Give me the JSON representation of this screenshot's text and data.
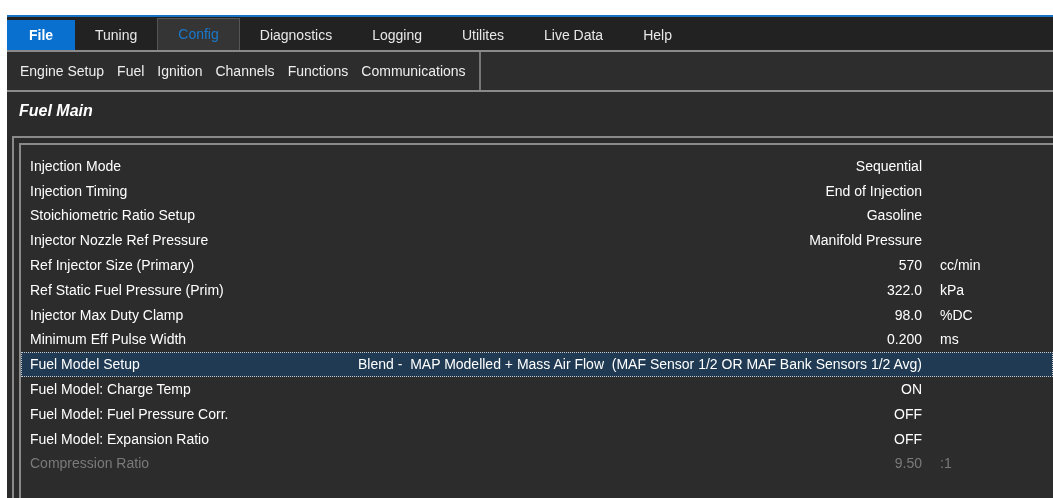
{
  "menu_tabs": [
    {
      "label": "File",
      "kind": "file",
      "selected": false
    },
    {
      "label": "Tuning",
      "kind": "tab",
      "selected": false
    },
    {
      "label": "Config",
      "kind": "tab",
      "selected": true
    },
    {
      "label": "Diagnostics",
      "kind": "tab",
      "selected": false
    },
    {
      "label": "Logging",
      "kind": "tab",
      "selected": false
    },
    {
      "label": "Utilites",
      "kind": "tab",
      "selected": false
    },
    {
      "label": "Live Data",
      "kind": "tab",
      "selected": false
    },
    {
      "label": "Help",
      "kind": "tab",
      "selected": false
    }
  ],
  "toolbar": {
    "items": [
      "Engine Setup",
      "Fuel",
      "Ignition",
      "Channels",
      "Functions",
      "Communications"
    ]
  },
  "panel": {
    "title": "Fuel Main"
  },
  "settings": [
    {
      "name": "Injection Mode",
      "value": "Sequential",
      "selected": false,
      "disabled": false
    },
    {
      "name": "Injection Timing",
      "value": "End of Injection",
      "selected": false,
      "disabled": false
    },
    {
      "name": "Stoichiometric Ratio Setup",
      "value": "Gasoline",
      "selected": false,
      "disabled": false
    },
    {
      "name": "Injector Nozzle Ref Pressure",
      "value": "Manifold Pressure",
      "selected": false,
      "disabled": false
    },
    {
      "name": "Ref Injector Size (Primary)",
      "value": "570",
      "unit": "cc/min",
      "selected": false,
      "disabled": false
    },
    {
      "name": "Ref Static Fuel Pressure (Prim)",
      "value": "322.0",
      "unit": "kPa",
      "selected": false,
      "disabled": false
    },
    {
      "name": "Injector Max Duty Clamp",
      "value": "98.0",
      "unit": "%DC",
      "selected": false,
      "disabled": false
    },
    {
      "name": "Minimum Eff Pulse Width",
      "value": "0.200",
      "unit": "ms",
      "selected": false,
      "disabled": false
    },
    {
      "name": "Fuel Model Setup",
      "value": "Blend -  MAP Modelled + Mass Air Flow  (MAF Sensor 1/2 OR MAF Bank Sensors 1/2 Avg)",
      "selected": true,
      "disabled": false
    },
    {
      "name": "Fuel Model: Charge Temp",
      "value": "ON",
      "selected": false,
      "disabled": false
    },
    {
      "name": "Fuel Model: Fuel Pressure Corr.",
      "value": "OFF",
      "selected": false,
      "disabled": false
    },
    {
      "name": "Fuel Model: Expansion Ratio",
      "value": "OFF",
      "selected": false,
      "disabled": false
    },
    {
      "name": "Compression Ratio",
      "value": "9.50",
      "unit": ":1",
      "selected": false,
      "disabled": true
    }
  ]
}
